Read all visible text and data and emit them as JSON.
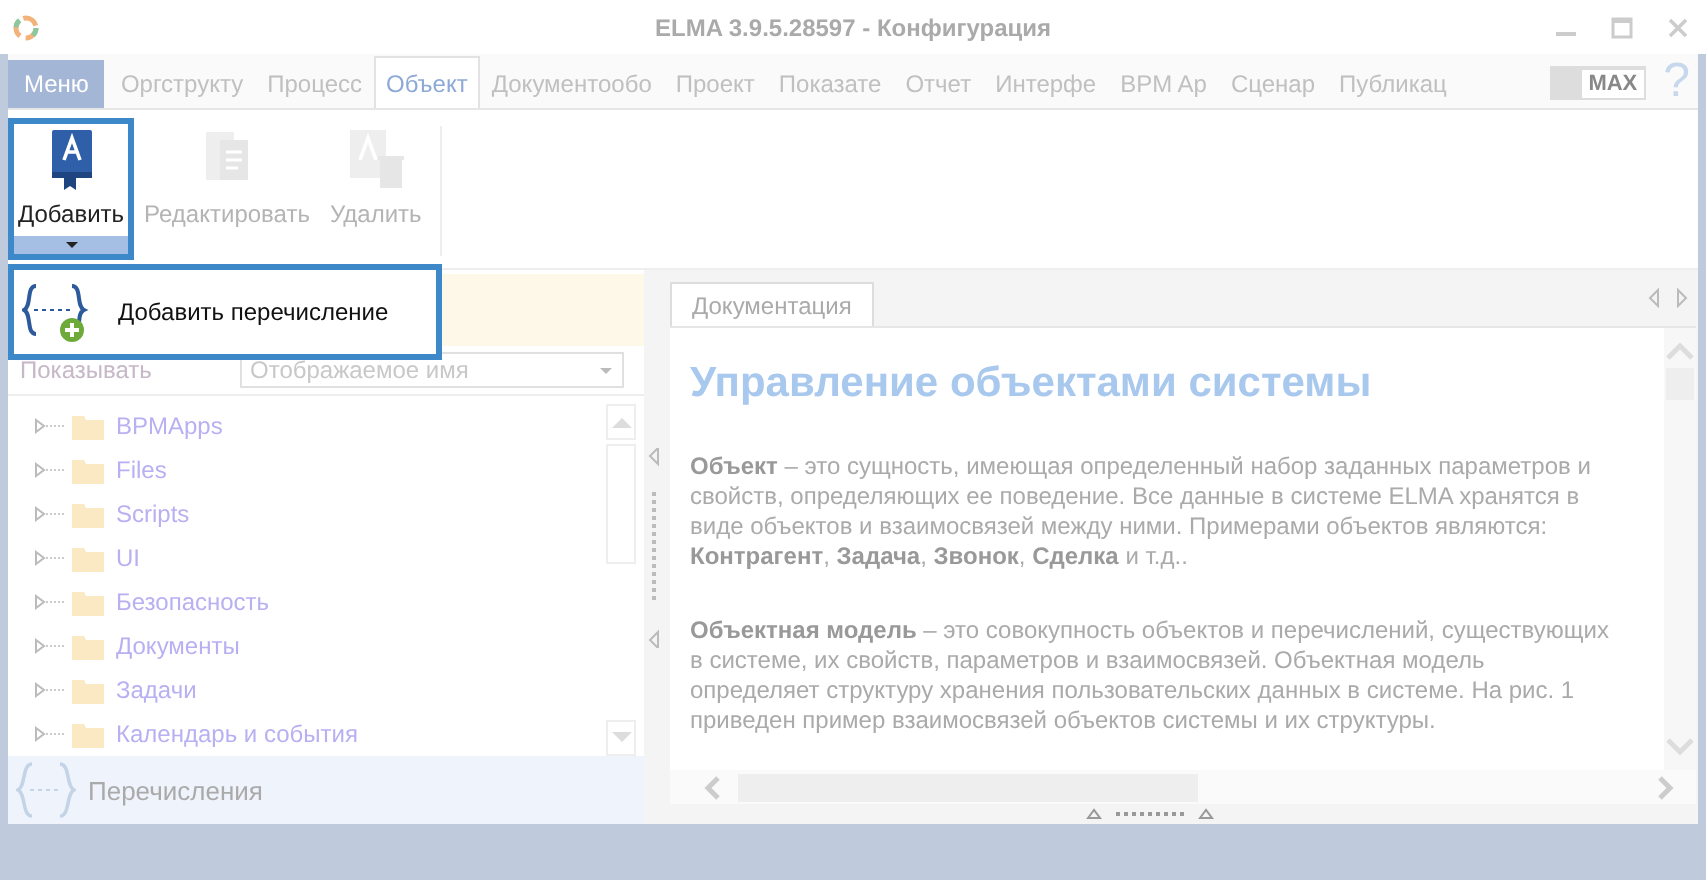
{
  "window": {
    "title": "ELMA 3.9.5.28597 - Конфигурация"
  },
  "menu_button": "Меню",
  "tabs": [
    {
      "label": "Оргструкту",
      "selected": false
    },
    {
      "label": "Процесс",
      "selected": false
    },
    {
      "label": "Объект",
      "selected": true
    },
    {
      "label": "Документообо",
      "selected": false
    },
    {
      "label": "Проект",
      "selected": false
    },
    {
      "label": "Показате",
      "selected": false
    },
    {
      "label": "Отчет",
      "selected": false
    },
    {
      "label": "Интерфе",
      "selected": false
    },
    {
      "label": "BPM Ap",
      "selected": false
    },
    {
      "label": "Сценар",
      "selected": false
    },
    {
      "label": "Публикац",
      "selected": false
    }
  ],
  "max_toggle": {
    "label": "MAX",
    "on": true
  },
  "help": "?",
  "ribbon": [
    {
      "kind": "add",
      "label": "Добавить",
      "disabled": false,
      "expanded": true
    },
    {
      "kind": "edit",
      "label": "Редактировать",
      "disabled": true
    },
    {
      "kind": "delete",
      "label": "Удалить",
      "disabled": true
    }
  ],
  "dropdown": [
    {
      "label": "Добавить перечисление"
    }
  ],
  "filter": {
    "label": "Показывать",
    "value": "Отображаемое имя"
  },
  "tree": [
    {
      "label": "BPMApps",
      "expanded": false
    },
    {
      "label": "Files",
      "expanded": false
    },
    {
      "label": "Scripts",
      "expanded": false
    },
    {
      "label": "UI",
      "expanded": false
    },
    {
      "label": "Безопасность",
      "expanded": false
    },
    {
      "label": "Документы",
      "expanded": false
    },
    {
      "label": "Задачи",
      "expanded": false
    },
    {
      "label": "Календарь и события",
      "expanded": false
    }
  ],
  "section": {
    "label": "Перечисления"
  },
  "doc_tab": {
    "label": "Документация"
  },
  "doc": {
    "heading": "Управление объектами системы",
    "paragraphs": [
      "**Объект** – это сущность, имеющая определенный набор заданных параметров и свойств, определяющих ее поведение. Все данные в системе ELMA хранятся в виде объектов и взаимосвязей между ними. Примерами объектов являются: **Контрагент**, **Задача**, **Звонок**, **Сделка** и т.д..",
      "**Объектная модель** – это совокупность объектов и перечислений, существующих в системе, их свойств, параметров и взаимосвязей. Объектная модель определяет структуру хранения пользовательских данных в системе. На рис. 1 приведен пример взаимосвязей объектов системы и их структуры."
    ]
  }
}
